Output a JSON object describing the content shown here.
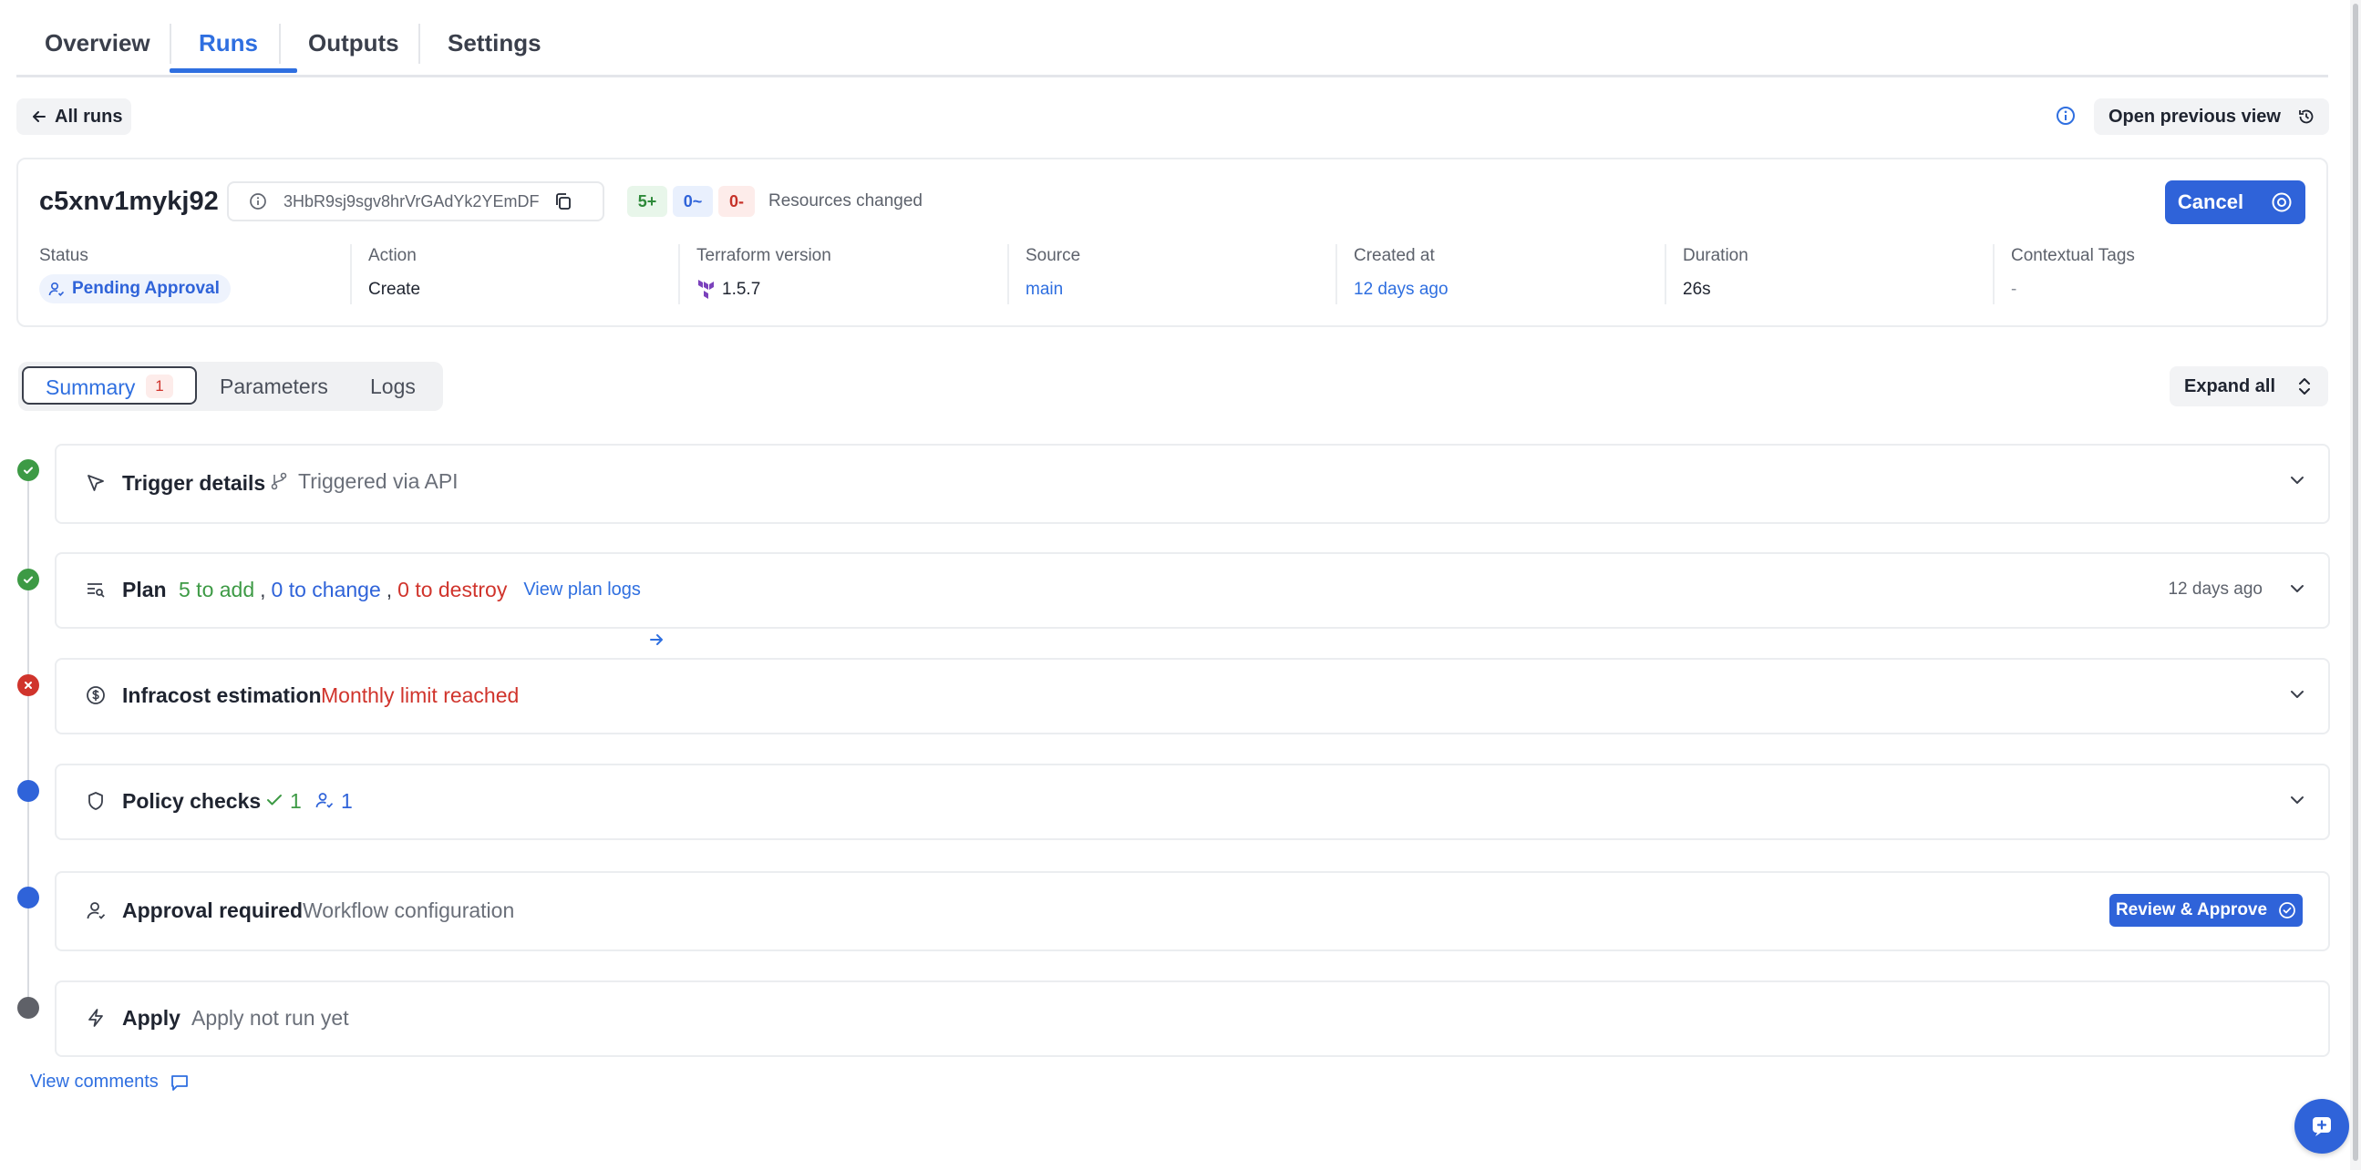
{
  "tabs": [
    "Overview",
    "Runs",
    "Outputs",
    "Settings"
  ],
  "toolbar": {
    "back_label": "All runs",
    "previous_view_label": "Open previous view"
  },
  "run": {
    "name": "c5xnv1mykj92",
    "id": "3HbR9sj9sgv8hrVrGAdYk2YEmDF",
    "changes": {
      "add": "5+",
      "change": "0~",
      "destroy": "0-",
      "label": "Resources changed"
    },
    "cancel_label": "Cancel",
    "meta": {
      "status": {
        "label": "Status",
        "value": "Pending Approval"
      },
      "action": {
        "label": "Action",
        "value": "Create"
      },
      "terraform": {
        "label": "Terraform version",
        "value": "1.5.7"
      },
      "source": {
        "label": "Source",
        "value": "main"
      },
      "created": {
        "label": "Created at",
        "value": "12 days ago"
      },
      "duration": {
        "label": "Duration",
        "value": "26s"
      },
      "tags": {
        "label": "Contextual Tags",
        "value": "-"
      }
    }
  },
  "subtabs": {
    "summary": "Summary",
    "summary_count": "1",
    "parameters": "Parameters",
    "logs": "Logs"
  },
  "expand_all_label": "Expand all",
  "steps": {
    "trigger": {
      "title": "Trigger details",
      "sub": "Triggered via API"
    },
    "plan": {
      "title": "Plan",
      "add": "5 to add",
      "sep": ",",
      "change": "0 to change",
      "destroy": "0 to destroy",
      "link": "View plan logs",
      "time": "12 days ago"
    },
    "infracost": {
      "title": "Infracost estimation",
      "sub": "Monthly limit reached"
    },
    "policy": {
      "title": "Policy checks",
      "passed": "1",
      "approval": "1"
    },
    "approval": {
      "title": "Approval required",
      "sub": "Workflow configuration",
      "button": "Review & Approve"
    },
    "apply": {
      "title": "Apply",
      "sub": "Apply not run yet"
    }
  },
  "comments_label": "View comments",
  "colors": {
    "accent": "#2f6fe0",
    "success": "#3d9a45",
    "danger": "#d0342c",
    "pending": "#2f63d9",
    "neutral": "#5f6168"
  }
}
